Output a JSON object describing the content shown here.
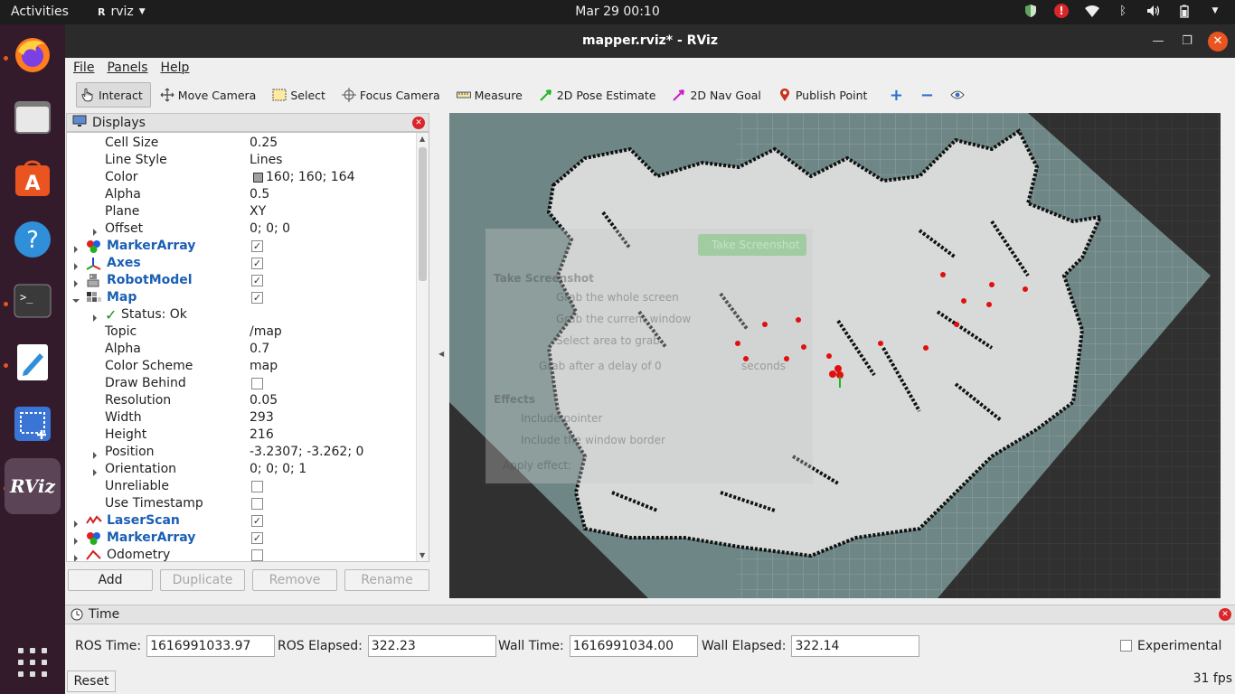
{
  "topbar": {
    "activities": "Activities",
    "app_name": "rviz",
    "clock": "Mar 29  00:10"
  },
  "window": {
    "title": "mapper.rviz* - RViz"
  },
  "menu": [
    "File",
    "Panels",
    "Help"
  ],
  "toolbar": {
    "interact": "Interact",
    "move_camera": "Move Camera",
    "select": "Select",
    "focus_camera": "Focus Camera",
    "measure": "Measure",
    "pose_estimate": "2D Pose Estimate",
    "nav_goal": "2D Nav Goal",
    "publish_point": "Publish Point"
  },
  "displays": {
    "title": "Displays",
    "rows": [
      {
        "name": "Cell Size",
        "value": "0.25"
      },
      {
        "name": "Line Style",
        "value": "Lines"
      },
      {
        "name": "Color",
        "value": "160; 160; 164"
      },
      {
        "name": "Alpha",
        "value": "0.5"
      },
      {
        "name": "Plane",
        "value": "XY"
      },
      {
        "name": "Offset",
        "value": "0; 0; 0"
      },
      {
        "name": "MarkerArray",
        "value": ""
      },
      {
        "name": "Axes",
        "value": ""
      },
      {
        "name": "RobotModel",
        "value": ""
      },
      {
        "name": "Map",
        "value": ""
      },
      {
        "name": "Status: Ok",
        "value": ""
      },
      {
        "name": "Topic",
        "value": "/map"
      },
      {
        "name": "Alpha",
        "value": "0.7"
      },
      {
        "name": "Color Scheme",
        "value": "map"
      },
      {
        "name": "Draw Behind",
        "value": ""
      },
      {
        "name": "Resolution",
        "value": "0.05"
      },
      {
        "name": "Width",
        "value": "293"
      },
      {
        "name": "Height",
        "value": "216"
      },
      {
        "name": "Position",
        "value": "-3.2307; -3.262; 0"
      },
      {
        "name": "Orientation",
        "value": "0; 0; 0; 1"
      },
      {
        "name": "Unreliable",
        "value": ""
      },
      {
        "name": "Use Timestamp",
        "value": ""
      },
      {
        "name": "LaserScan",
        "value": ""
      },
      {
        "name": "MarkerArray",
        "value": ""
      },
      {
        "name": "Odometry",
        "value": ""
      }
    ],
    "buttons": {
      "add": "Add",
      "duplicate": "Duplicate",
      "remove": "Remove",
      "rename": "Rename"
    }
  },
  "screenshot_overlay": {
    "button": "Take Screenshot",
    "heading": "Take Screenshot",
    "opt1": "Grab the whole screen",
    "opt2": "Grab the current window",
    "opt3": "Select area to grab",
    "delay_label": "Grab after a delay of",
    "delay_value": "0",
    "delay_unit": "seconds",
    "effects": "Effects",
    "include_pointer": "Include pointer",
    "include_border": "Include the window border",
    "apply_effect": "Apply effect:"
  },
  "time": {
    "title": "Time",
    "ros_time_label": "ROS Time:",
    "ros_time": "1616991033.97",
    "ros_elapsed_label": "ROS Elapsed:",
    "ros_elapsed": "322.23",
    "wall_time_label": "Wall Time:",
    "wall_time": "1616991034.00",
    "wall_elapsed_label": "Wall Elapsed:",
    "wall_elapsed": "322.14",
    "experimental": "Experimental",
    "reset": "Reset",
    "fps": "31 fps"
  },
  "colors": {
    "accent": "#e95420",
    "dock": "#331b2b",
    "display_blue": "#1b5fb5",
    "marker_red": "#e01010"
  }
}
